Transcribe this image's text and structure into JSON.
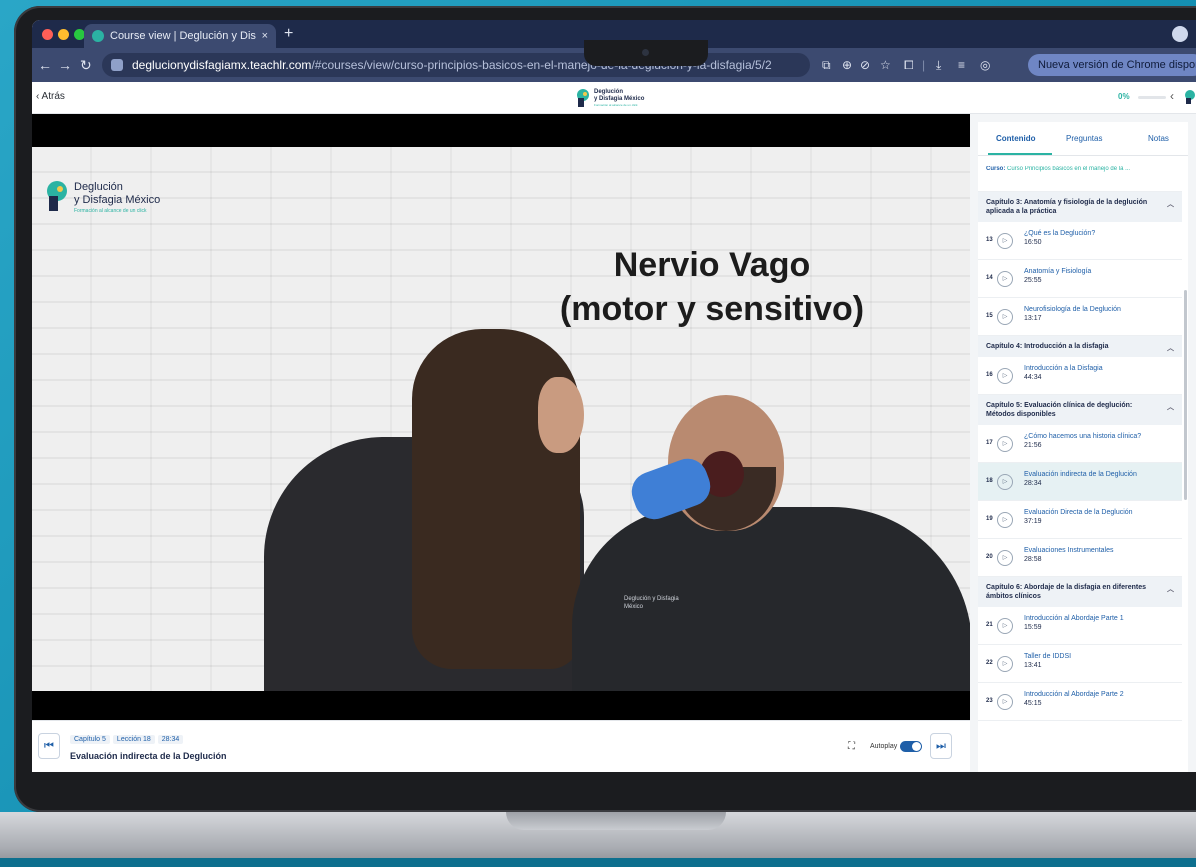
{
  "browser": {
    "tab_title": "Course view | Deglución y Dis",
    "tab_close": "×",
    "new_tab": "+",
    "url_domain": "deglucionydisfagiamx.teachlr.com",
    "url_path": "/#courses/view/curso-principios-basicos-en-el-manejo-de-la-deglucion-y-la-disfagia/5/2",
    "update_label": "Nueva versión de Chrome disponible",
    "colors": {
      "tabbar": "#1e2a4a",
      "toolbar": "#3c4a70",
      "update": "#6f86c4"
    }
  },
  "header": {
    "back_label": "‹ Atrás",
    "logo_line1": "Deglución",
    "logo_line2": "y Disfagia México",
    "logo_line3": "Formación al alcance de un click",
    "progress_label": "0%",
    "progress_fraction": 0
  },
  "video": {
    "logo_line1": "Deglución",
    "logo_line2": "y Disfagia México",
    "logo_line3": "Formación al alcance de un click",
    "title_line1": "Nervio Vago",
    "title_line2": "(motor y sensitivo)",
    "shirt_text": "Deglución y Disfagia México"
  },
  "controls": {
    "chapter": "Capítulo 5",
    "lesson": "Lección 18",
    "duration": "28:34",
    "title": "Evaluación indirecta de la Deglución",
    "autoplay_label": "Autoplay",
    "autoplay_on": true
  },
  "sidebar": {
    "tabs": [
      "Contenido",
      "Preguntas",
      "Notas"
    ],
    "course_label": "Curso:",
    "course_name": "Curso Principios básicos en el manejo de la ...",
    "chapters": [
      {
        "title": "Capítulo 3: Anatomía y fisiología de la deglución aplicada a la práctica",
        "lessons": [
          {
            "num": "13",
            "title": "¿Qué es la Deglución?",
            "duration": "16:50"
          },
          {
            "num": "14",
            "title": "Anatomía y Fisiología",
            "duration": "25:55"
          },
          {
            "num": "15",
            "title": "Neurofisiología de la Deglución",
            "duration": "13:17"
          }
        ]
      },
      {
        "title": "Capítulo 4: Introducción a la disfagia",
        "lessons": [
          {
            "num": "16",
            "title": "Introducción a la Disfagia",
            "duration": "44:34"
          }
        ]
      },
      {
        "title": "Capítulo 5: Evaluación clínica de deglución: Métodos disponibles",
        "lessons": [
          {
            "num": "17",
            "title": "¿Cómo hacemos una historia clínica?",
            "duration": "21:56"
          },
          {
            "num": "18",
            "title": "Evaluación indirecta de la Deglución",
            "duration": "28:34",
            "active": true
          },
          {
            "num": "19",
            "title": "Evaluación Directa de la Deglución",
            "duration": "37:19"
          },
          {
            "num": "20",
            "title": "Evaluaciones Instrumentales",
            "duration": "28:58"
          }
        ]
      },
      {
        "title": "Capítulo 6: Abordaje de la disfagia en diferentes ámbitos clínicos",
        "lessons": [
          {
            "num": "21",
            "title": "Introducción al Abordaje Parte 1",
            "duration": "15:59"
          },
          {
            "num": "22",
            "title": "Taller de IDDSI",
            "duration": "13:41"
          },
          {
            "num": "23",
            "title": "Introducción al Abordaje Parte 2",
            "duration": "45:15"
          }
        ]
      }
    ],
    "colors": {
      "accent": "#2bb3a3",
      "link": "#1f5fa8",
      "active_row": "#e6f1f3"
    }
  }
}
